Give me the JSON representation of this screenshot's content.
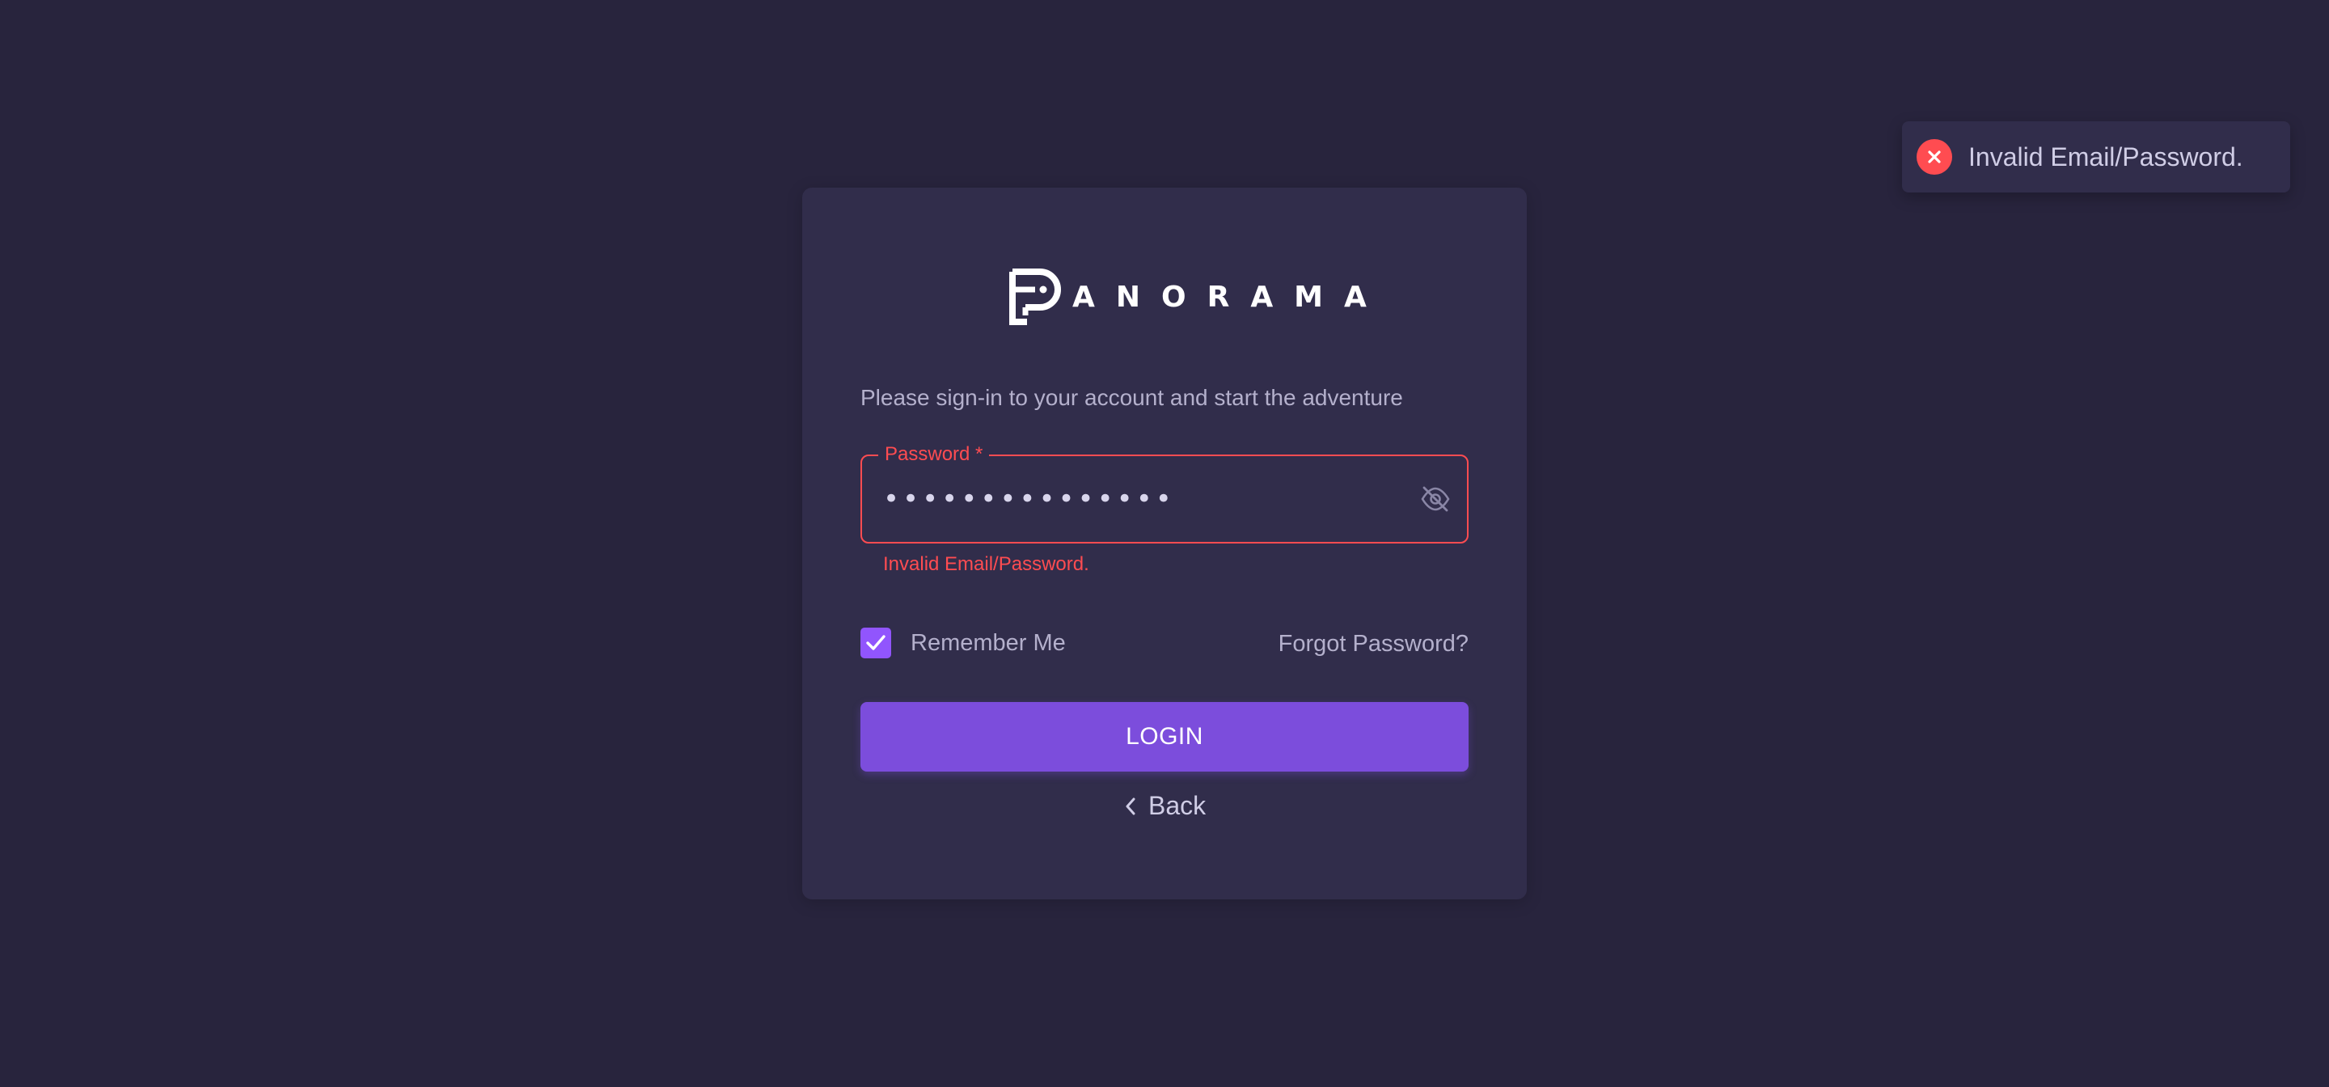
{
  "toast": {
    "message": "Invalid Email/Password.",
    "icon": "close-circle-icon",
    "color": "#ff4c51"
  },
  "brand": {
    "name": "PANORAMA",
    "wordmark": "ANORAMA",
    "logo_icon": "panorama-logo-mark"
  },
  "login": {
    "subtitle": "Please sign-in to your account and start the adventure",
    "password": {
      "label": "Password *",
      "value": "•••••••••••••••",
      "toggle_icon": "eye-off-icon"
    },
    "error": "Invalid Email/Password.",
    "remember_label": "Remember Me",
    "remember_checked": true,
    "forgot_label": "Forgot Password?",
    "login_label": "LOGIN",
    "back_label": "Back"
  },
  "colors": {
    "background": "#28243d",
    "card": "#312d4b",
    "accent": "#9155fd",
    "button": "#7c4ddc",
    "error": "#ff4c51"
  }
}
